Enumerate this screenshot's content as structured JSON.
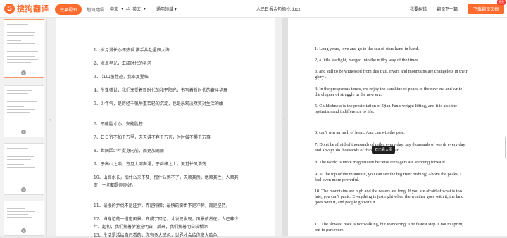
{
  "app": {
    "logo_text": "搜狗翻译",
    "logo_mark": "S"
  },
  "toolbar": {
    "view_toggle": [
      "效果视图",
      "划词对照"
    ],
    "source_lang": "中文",
    "arrow": "⇄",
    "target_lang": "英文",
    "dropdown_caret": "▾",
    "field": "通用领域 ▾",
    "doc_title": "人民日报金句摘抄.docx",
    "feedback": "我要纠错",
    "next": "翻译下一篇",
    "download": "下载翻译文档",
    "badge": "限免"
  },
  "thumbnails": [
    {
      "page": "1",
      "active": true
    },
    {
      "page": "2",
      "active": false
    },
    {
      "page": "3",
      "active": false
    },
    {
      "page": "4",
      "active": false
    }
  ],
  "source": [
    "1、岁月漫长心怀热爱 携手共赴星辰大海",
    "2、点点星光，汇成时代的星河",
    "3、 江山留胜迹，我辈复登临",
    "4、生逢盛世，我们享受着新时代的和平阳光，书写着新时代的奋斗华章",
    "5、少年气，是历经千帆举重若轻的沉淀，也是乐观淡然笑对生活的酣",
    "6、不能胜寸心，安能胜苍",
    "7、日日行不怕千万里，天天讲不弃千万言，时时做不惧千万事",
    "8、世间因少年挺身向前，而更加瑰丽",
    "9、于高山之巅，方见大河奔涌；于群峰之上，更觉长风浩荡",
    "10、山高水长，怕什么来不及，慌什么到不了，天顺其然，地顺其性，人顺其",
    "变，一切都是刚刚好。",
    "11、最慢的步伐不是跬步，而是徘徊；最快的脚步不是冲刺，而是坚持。",
    "12、当身边的一道道风景，变成了回忆，才发现发现，风景依然在，人已非少",
    "年。起初，我们揣着梦遍览明白；后来，我们揣着明白装糊涂",
    "13、生活是活给自己看的，你有多大成色，世界才会给你多大脸色",
    "14、从当下这一刻起，把握内耗，做行动的巨人。只因，命运，不会偏祖任何",
    "人，却会眷顾一直朝着光亮前进的人。"
  ],
  "target": [
    "1. Long years, love and go to the sea of stars hand in hand.",
    "2, a little starlight, merged into the milky way of the times.",
    "3. and still to be witnessed from this trail, rivers and mountains are changeless in their",
    "glory .",
    "4. In the prosperous times, we enjoy the sunshine of peace in the new era and write",
    "the chapter of struggle in the new era.",
    "5. Childishness is the precipitation of Qian Fan's weight lifting, and it is also the",
    "optimism and indifference to life.",
    "6, can't win an inch of heart, Ann can win the pale.",
    "7. Don't be afraid of thousands of miles every day, say thousands of words every day,",
    "and always do thousands of things without fear.",
    "8. The world is more magnificent because teenagers are stepping forward.",
    "9. At the top of the mountain, you can see the big river rushing; Above the peaks, I",
    "feel even more powerful.",
    "10. The mountains are high and the waters are long. If you are afraid of what is too",
    "late, you can't panic. Everything is just right when the weather goes with it, the land",
    "goes with it, and people go with it.",
    "11. The slowest pace is not walking, but wandering; The fastest step is not to sprint,",
    "but to persevere."
  ],
  "tooltip": "双击看大图",
  "colors": {
    "brand": "#ff6b2c",
    "badge": "#ff3b30"
  }
}
